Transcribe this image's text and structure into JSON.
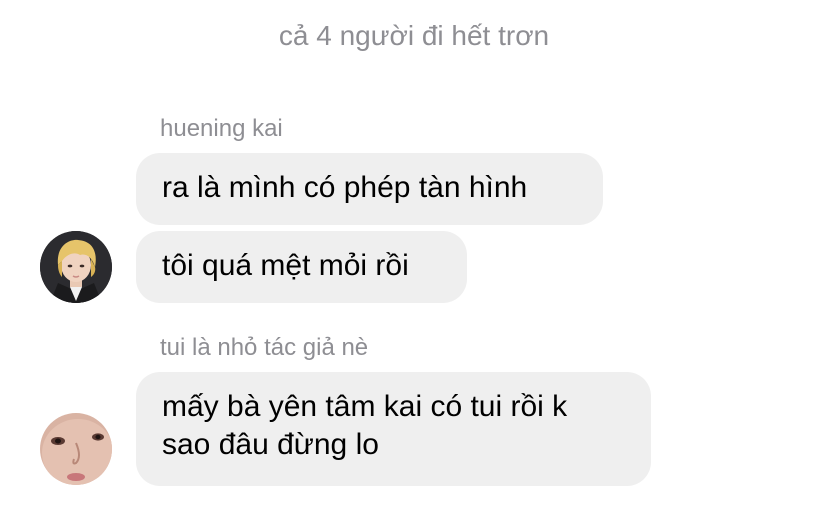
{
  "system_message": "cả 4 người đi hết trơn",
  "groups": [
    {
      "sender": "huening kai",
      "avatar": "blond-boy-avatar",
      "messages": [
        "ra là mình có phép tàn hình",
        "tôi quá mệt mỏi rồi"
      ]
    },
    {
      "sender": "tui là nhỏ tác giả nè",
      "avatar": "face-closeup-avatar",
      "messages": [
        "mấy bà yên tâm kai có tui rồi k\nsao đâu đừng lo"
      ]
    }
  ],
  "colors": {
    "bubble": "#efefef",
    "meta_text": "#8e8e93",
    "background": "#ffffff"
  }
}
